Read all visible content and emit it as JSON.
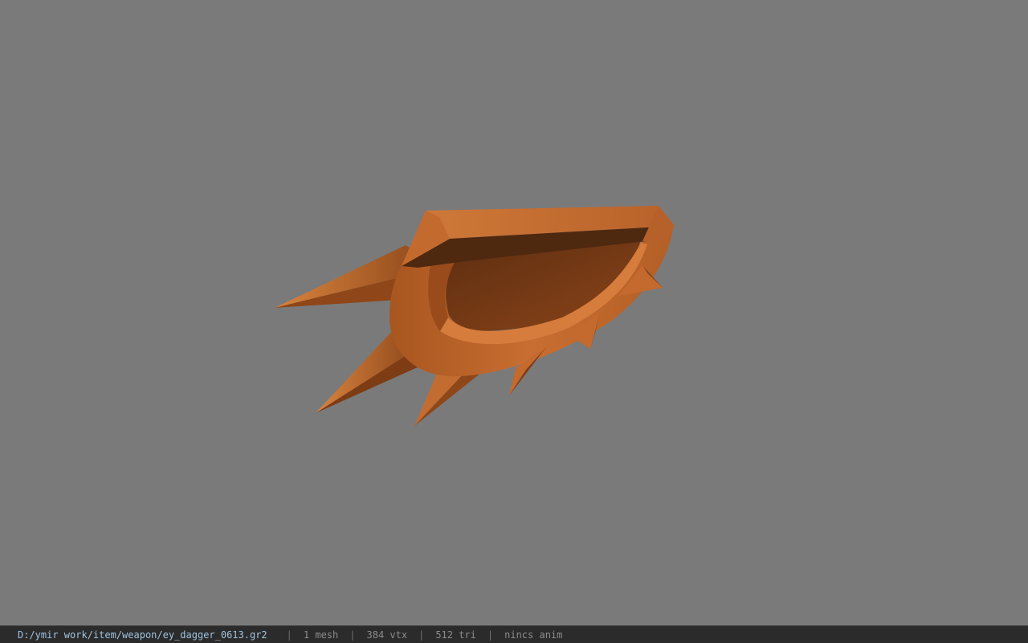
{
  "viewer": {
    "background_color": "#7a7a7a",
    "model_colors": {
      "lit": "#c46a2e",
      "mid": "#a5531f",
      "dark": "#6b3312",
      "shadow": "#4a2611"
    }
  },
  "status_bar": {
    "file_path": "D:/ymir work/item/weapon/ey_dagger_0613.gr2",
    "separator": "|",
    "mesh_count": "1 mesh",
    "vertex_count": "384 vtx",
    "triangle_count": "512 tri",
    "anim_status": "nincs anim"
  }
}
